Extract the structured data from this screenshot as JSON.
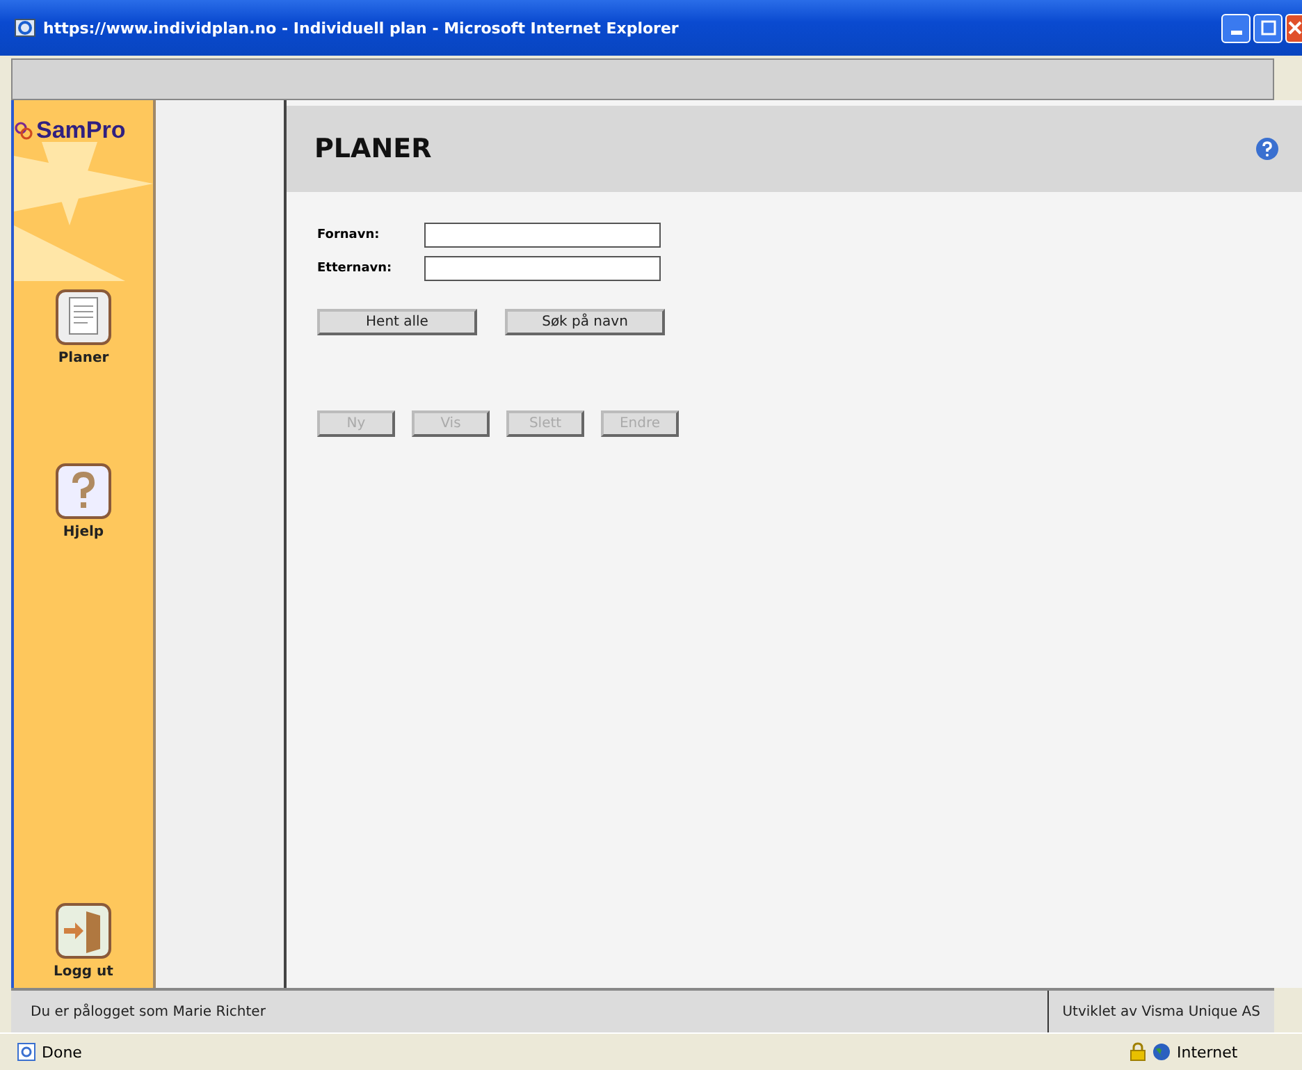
{
  "window": {
    "title": "https://www.individplan.no - Individuell plan - Microsoft Internet Explorer"
  },
  "sidebar": {
    "logo": "SamPro",
    "items": [
      {
        "label": "Planer",
        "kind": "plans"
      },
      {
        "label": "Hjelp",
        "kind": "help"
      },
      {
        "label": "Logg ut",
        "kind": "logout"
      }
    ]
  },
  "page": {
    "heading": "PLANER",
    "fields": [
      {
        "label": "Fornavn:"
      },
      {
        "label": "Etternavn:"
      }
    ],
    "search_buttons": [
      {
        "label": "Hent alle",
        "disabled": false
      },
      {
        "label": "Søk på navn",
        "disabled": false
      }
    ],
    "action_buttons": [
      {
        "label": "Ny",
        "disabled": true
      },
      {
        "label": "Vis",
        "disabled": true
      },
      {
        "label": "Slett",
        "disabled": true
      },
      {
        "label": "Endre",
        "disabled": true
      }
    ]
  },
  "footer": {
    "user": "Du er pålogget som Marie Richter",
    "credit": "Utviklet av Visma Unique AS"
  },
  "status_bar": {
    "status": "Done",
    "zone": "Internet"
  }
}
